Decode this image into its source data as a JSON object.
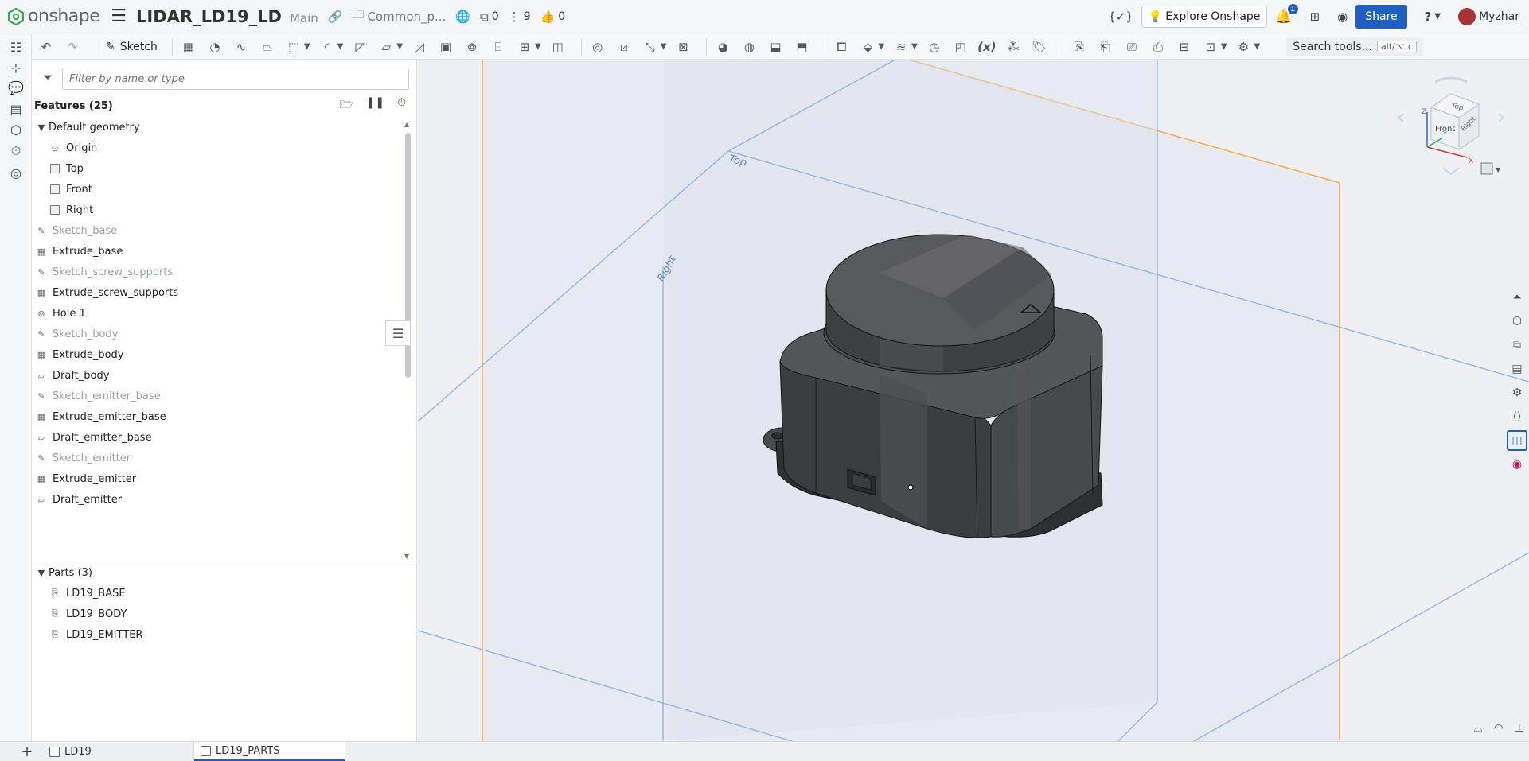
{
  "header": {
    "logo_text": "onshape",
    "doc_title": "LIDAR_LD19_LD",
    "branch": "Main",
    "folder": "Common_p...",
    "versions_count": "0",
    "branches_count": "9",
    "likes_count": "0",
    "explore_label": "Explore Onshape",
    "notifications_count": "1",
    "share_label": "Share",
    "help_label": "?",
    "user_name": "Myzhar"
  },
  "toolbar": {
    "sketch_label": "Sketch",
    "search_label": "Search tools...",
    "search_shortcut": "alt/⌥ c"
  },
  "panel": {
    "filter_placeholder": "Filter by name or type",
    "features_title": "Features (25)",
    "default_geometry_label": "Default geometry",
    "default_geometry": [
      {
        "label": "Origin"
      },
      {
        "label": "Top"
      },
      {
        "label": "Front"
      },
      {
        "label": "Right"
      }
    ],
    "features": [
      {
        "label": "Sketch_base",
        "kind": "sketch"
      },
      {
        "label": "Extrude_base",
        "kind": "extrude"
      },
      {
        "label": "Sketch_screw_supports",
        "kind": "sketch"
      },
      {
        "label": "Extrude_screw_supports",
        "kind": "extrude"
      },
      {
        "label": "Hole 1",
        "kind": "hole"
      },
      {
        "label": "Sketch_body",
        "kind": "sketch"
      },
      {
        "label": "Extrude_body",
        "kind": "extrude"
      },
      {
        "label": "Draft_body",
        "kind": "draft"
      },
      {
        "label": "Sketch_emitter_base",
        "kind": "sketch"
      },
      {
        "label": "Extrude_emitter_base",
        "kind": "extrude"
      },
      {
        "label": "Draft_emitter_base",
        "kind": "draft"
      },
      {
        "label": "Sketch_emitter",
        "kind": "sketch"
      },
      {
        "label": "Extrude_emitter",
        "kind": "extrude"
      },
      {
        "label": "Draft_emitter",
        "kind": "draft"
      }
    ],
    "parts_title": "Parts (3)",
    "parts": [
      {
        "label": "LD19_BASE"
      },
      {
        "label": "LD19_BODY"
      },
      {
        "label": "LD19_EMITTER"
      }
    ]
  },
  "viewport": {
    "plane_top_label": "Top",
    "plane_right_label": "Right",
    "cube_top": "Top",
    "cube_front": "Front",
    "cube_right": "Right",
    "axis_x": "X",
    "axis_y": "Y",
    "axis_z": "Z"
  },
  "tabs": [
    {
      "label": "LD19",
      "active": false
    },
    {
      "label": "LD19_PARTS",
      "active": true
    }
  ],
  "colors": {
    "accent": "#1f5fbf",
    "plane_edge_blue": "#8fb3dd",
    "plane_edge_orange": "#f2a94a",
    "model_dark": "#3e3f42"
  }
}
